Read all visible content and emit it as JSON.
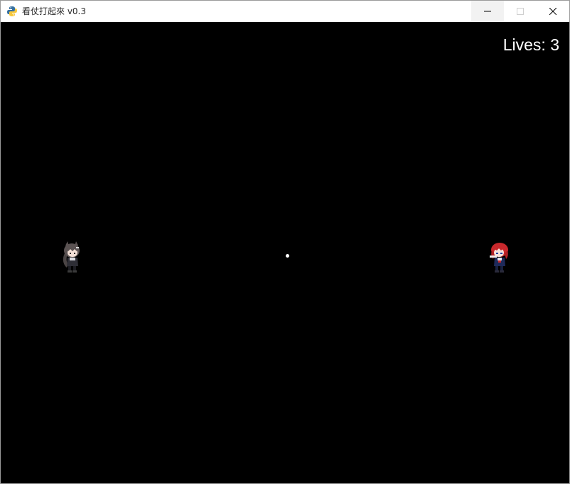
{
  "window": {
    "title": "看仗打起來 v0.3",
    "icon": "python-icon",
    "controls": {
      "minimize": "minimize-icon",
      "maximize": "maximize-icon",
      "close": "close-icon"
    }
  },
  "hud": {
    "lives_text": "Lives: 3"
  },
  "colors": {
    "background": "#000000",
    "hud_text": "#ffffff",
    "ball": "#ffffff",
    "left_character_hair": "#5a5252",
    "right_character_hair": "#c8282c"
  },
  "entities": {
    "left_character": "gray-haired-chibi-sprite",
    "right_character": "red-haired-chibi-sprite",
    "ball": "white-ball"
  }
}
